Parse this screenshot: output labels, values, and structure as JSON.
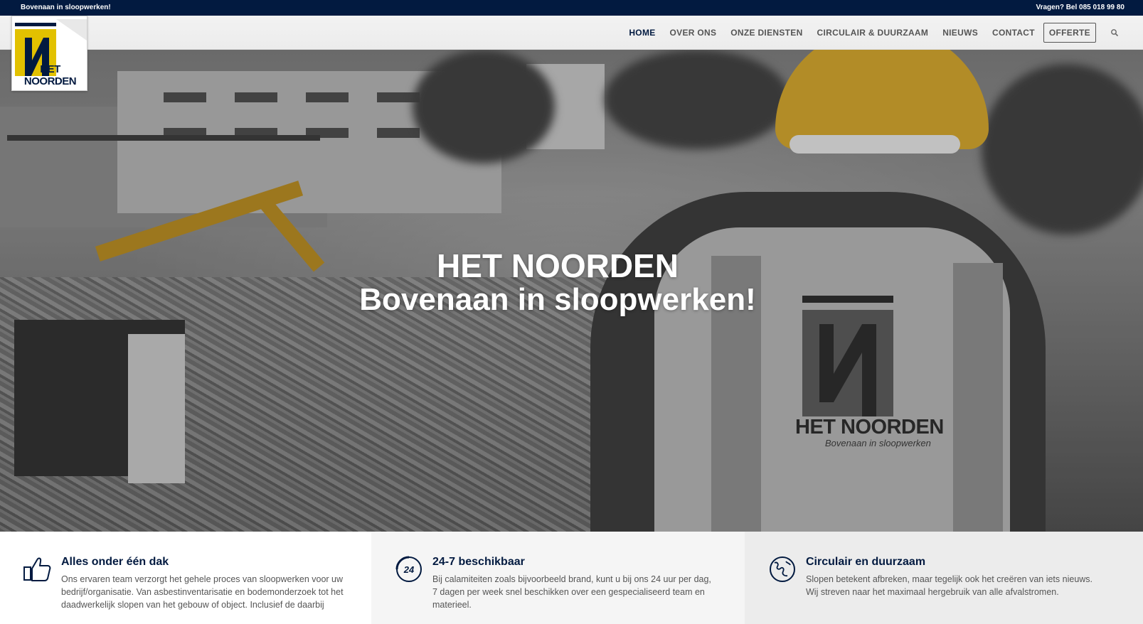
{
  "topbar": {
    "tagline": "Bovenaan in sloopwerken!",
    "contact": "Vragen? Bel 085 018 99 80"
  },
  "logo": {
    "text": "HET NOORDEN"
  },
  "nav": {
    "items": [
      {
        "label": "HOME",
        "active": true
      },
      {
        "label": "OVER ONS"
      },
      {
        "label": "ONZE DIENSTEN"
      },
      {
        "label": "CIRCULAIR & DUURZAAM"
      },
      {
        "label": "NIEUWS"
      },
      {
        "label": "CONTACT"
      }
    ],
    "cta": "OFFERTE",
    "search_icon": "search-icon"
  },
  "hero": {
    "title": "HET NOORDEN",
    "subtitle": "Bovenaan in sloopwerken!",
    "vest_text": "HET NOORDEN",
    "vest_sub": "Bovenaan in sloopwerken"
  },
  "features": [
    {
      "icon": "thumbs-up-icon",
      "title": "Alles onder één dak",
      "desc": "Ons ervaren team verzorgt het gehele proces van sloopwerken voor uw bedrijf/organisatie. Van asbestinventarisatie en bodemonderzoek tot het daadwerkelijk slopen van het gebouw of object. Inclusief de daarbij"
    },
    {
      "icon": "24-7-icon",
      "title": "24-7 beschikbaar",
      "desc": "Bij calamiteiten zoals bijvoorbeeld brand, kunt u bij ons 24 uur per dag, 7 dagen per week snel beschikken over een gespecialiseerd team en materieel."
    },
    {
      "icon": "globe-icon",
      "title": "Circulair en duurzaam",
      "desc": "Slopen betekent afbreken, maar tegelijk ook het creëren van iets nieuws. Wij streven naar het maximaal hergebruik van alle afvalstromen."
    }
  ],
  "colors": {
    "navy": "#021a40",
    "yellow": "#e2c100"
  }
}
